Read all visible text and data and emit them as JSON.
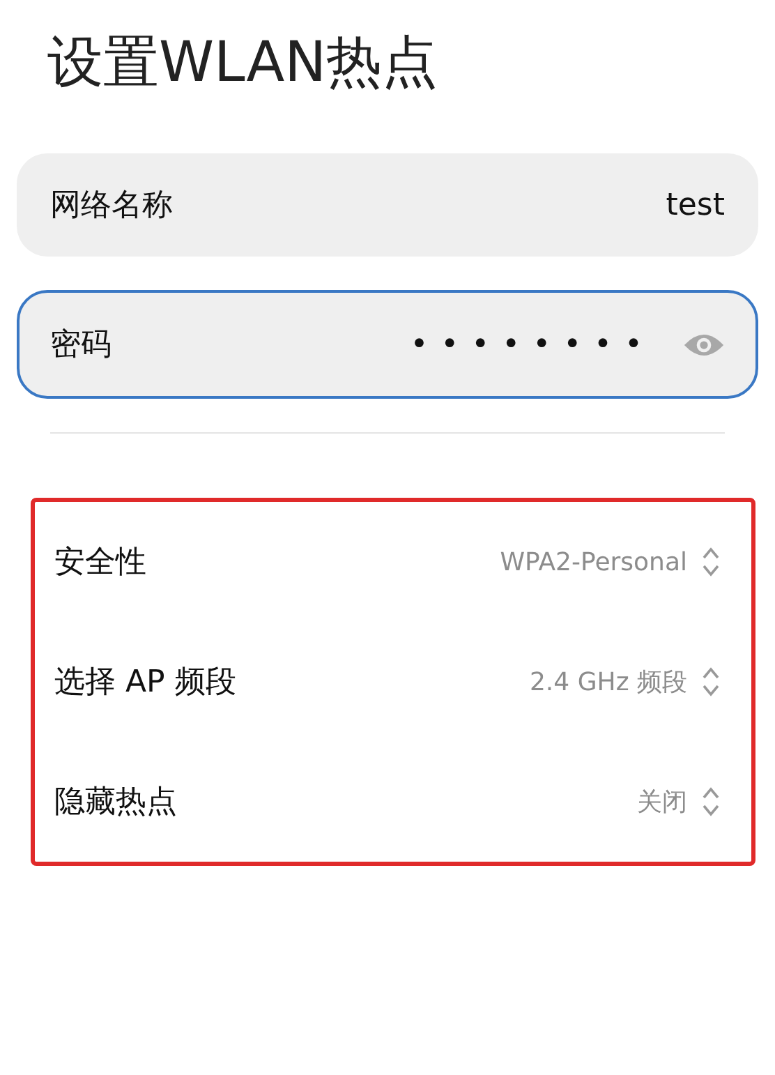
{
  "title": "设置WLAN热点",
  "fields": [
    {
      "kind": "text",
      "label": "网络名称",
      "value": "test",
      "focused": false
    },
    {
      "kind": "password",
      "label": "密码",
      "value": "••••••••",
      "focused": true
    }
  ],
  "settings": {
    "highlighted": true,
    "rows": [
      {
        "label": "安全性",
        "value": "WPA2-Personal"
      },
      {
        "label": "选择 AP 频段",
        "value": "2.4 GHz 频段"
      },
      {
        "label": "隐藏热点",
        "value": "关闭"
      }
    ]
  }
}
